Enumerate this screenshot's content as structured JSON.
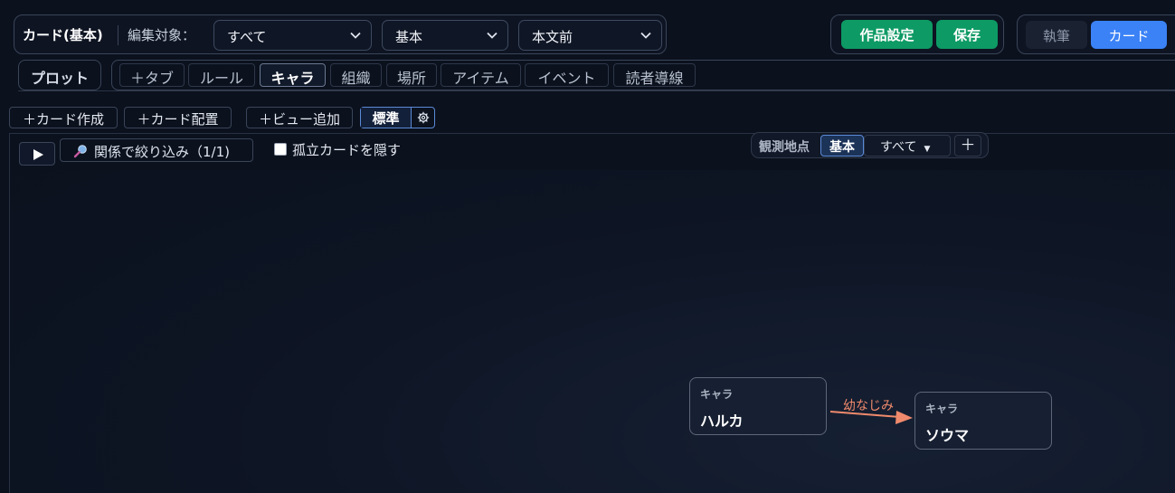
{
  "header": {
    "title": "カード(基本)",
    "edit_target_label": "編集対象：",
    "select_scope": "すべて",
    "select_layer": "基本",
    "select_position": "本文前",
    "settings_button": "作品設定",
    "save_button": "保存",
    "mode_write": "執筆",
    "mode_card": "カード"
  },
  "tabs": {
    "plot": "プロット",
    "items": [
      "＋タブ",
      "ルール",
      "キャラ",
      "組織",
      "場所",
      "アイテム",
      "イベント",
      "読者導線"
    ],
    "active": "キャラ"
  },
  "toolbar": {
    "create_card": "＋カード作成",
    "place_card": "＋カード配置",
    "add_view": "＋ビュー追加",
    "view_standard": "標準",
    "gear_icon": "gear-icon"
  },
  "canvas_controls": {
    "filter_label": "関係で絞り込み（1/1)",
    "hide_isolated_label": "孤立カードを隠す",
    "hide_isolated_checked": false,
    "observation_label": "観測地点",
    "observation_basic": "基本",
    "observation_all": "すべて",
    "observation_add": "＋"
  },
  "cards": [
    {
      "kind": "キャラ",
      "name": "ハルカ"
    },
    {
      "kind": "キャラ",
      "name": "ソウマ"
    }
  ],
  "relations": [
    {
      "from": "ハルカ",
      "to": "ソウマ",
      "label": "幼なじみ",
      "color": "#f08a6c"
    }
  ],
  "colors": {
    "accent_blue": "#3b82f6",
    "save_green": "#0d9a64",
    "relation": "#f08a6c",
    "background": "#0b111d"
  }
}
